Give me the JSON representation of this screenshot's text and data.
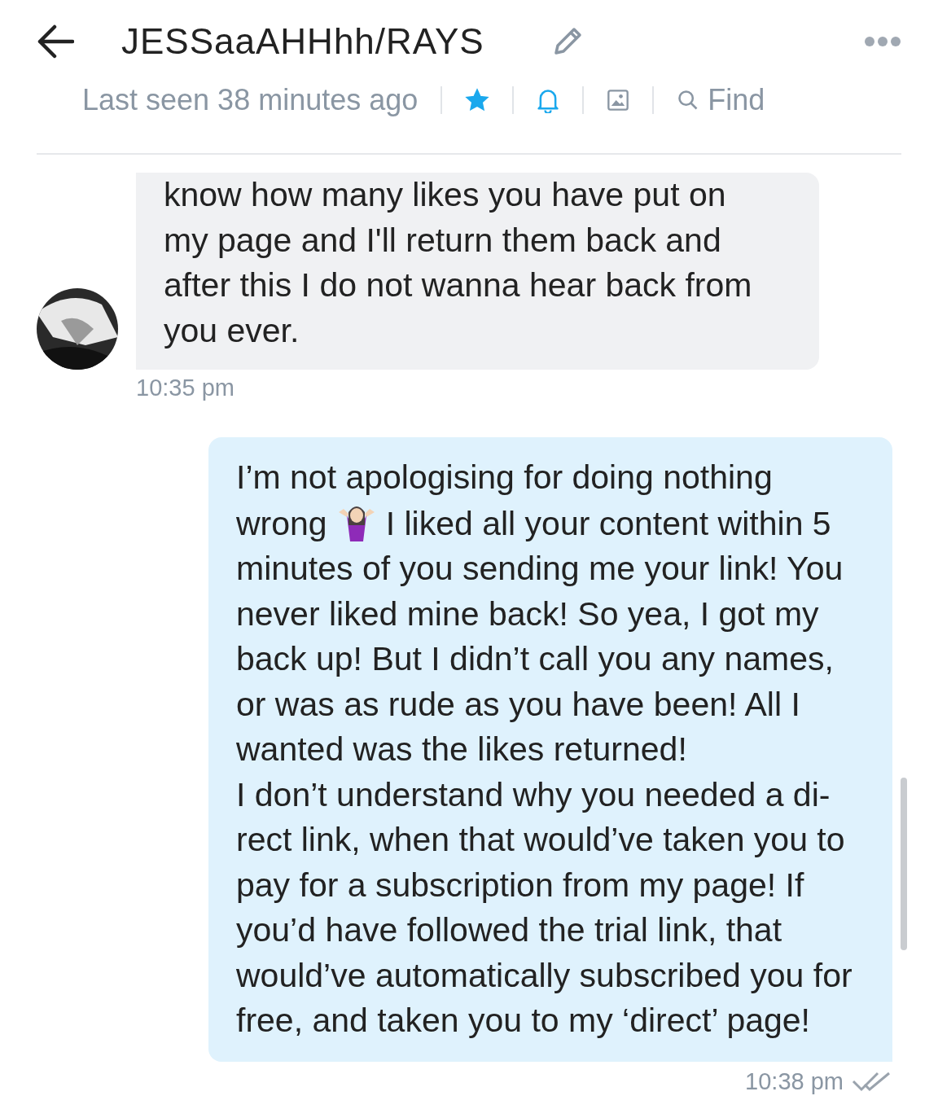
{
  "header": {
    "title": "JESSaaAHHhh/RAYS",
    "status": "Last seen 38 minutes ago",
    "favorite": true,
    "find_label": "Find"
  },
  "messages": [
    {
      "kind": "received",
      "paragraphs": [
        {
          "segments": [
            {
              "kind": "text",
              "text": "know how many likes you have put on my page and I'll return them back and after this I do not wanna hear back from you ever."
            }
          ]
        }
      ],
      "time": "10:35 pm"
    },
    {
      "kind": "sent",
      "paragraphs": [
        {
          "segments": [
            {
              "kind": "text",
              "text": "I’m not apologising for doing nothing"
            },
            {
              "kind": "text",
              "text": "wrong"
            },
            {
              "kind": "emoji"
            },
            {
              "kind": "text",
              "text": "I liked all your content within 5"
            },
            {
              "kind": "text",
              "text": "minutes of you sending me your link! You never liked mine back! So yea, I got my back up! But I didn’t call you any names, or was as rude as you have been! All I wanted was the likes returned!"
            }
          ]
        },
        {
          "segments": [
            {
              "kind": "text",
              "text": "I don’t understand why you needed a di-rect link, when that would’ve taken you to pay for a subscription from my page! If you’d have followed the trial link, that would’ve automatically subscribed you for free, and taken you to my ‘direct’ page!"
            }
          ]
        }
      ],
      "time": "10:38 pm",
      "read": true
    }
  ]
}
